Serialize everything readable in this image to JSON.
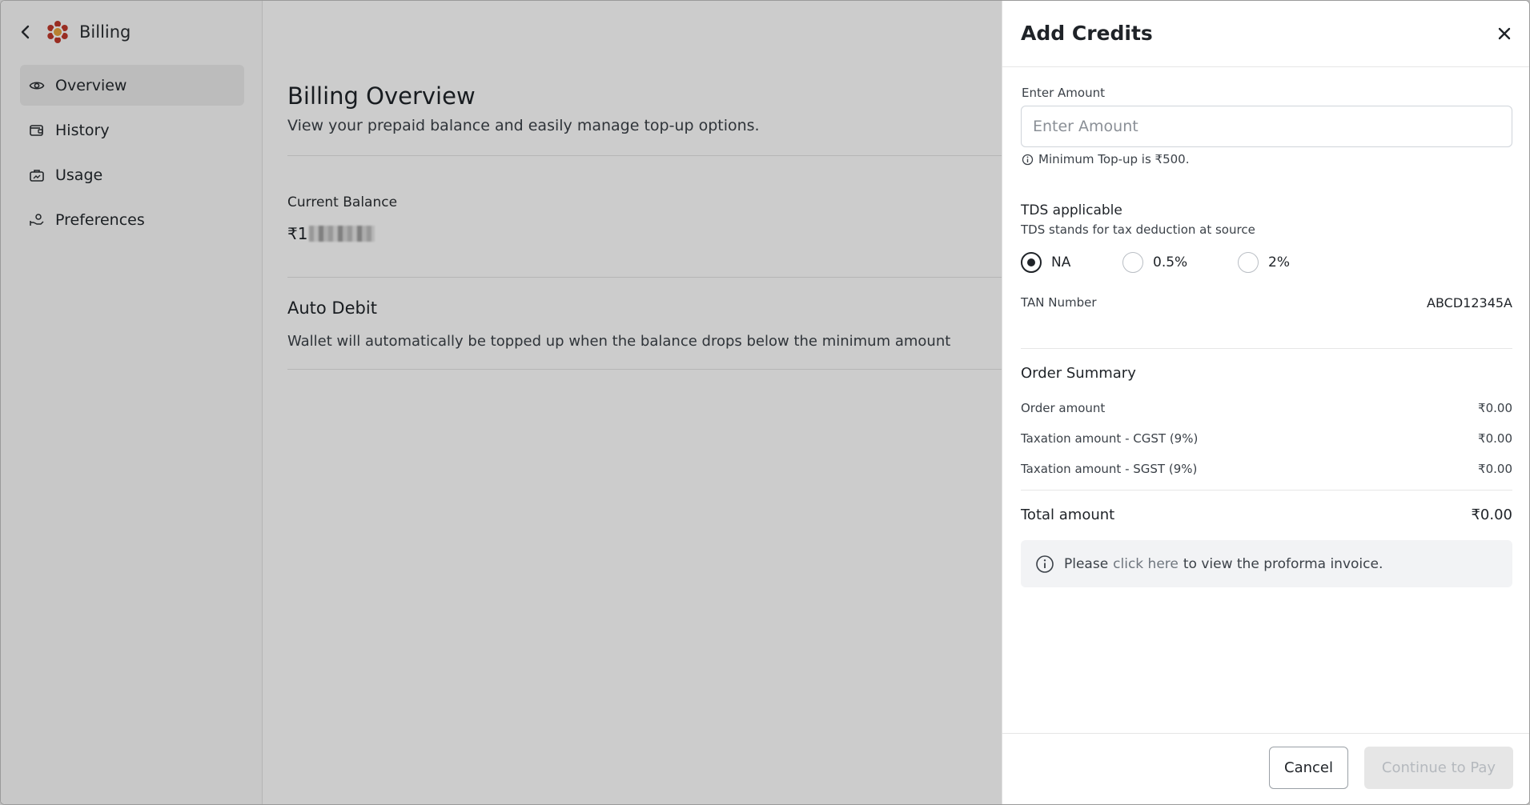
{
  "sidebar": {
    "title": "Billing",
    "items": [
      {
        "label": "Overview",
        "icon": "eye-icon",
        "active": true
      },
      {
        "label": "History",
        "icon": "wallet-icon"
      },
      {
        "label": "Usage",
        "icon": "briefcase-chart-icon"
      },
      {
        "label": "Preferences",
        "icon": "hand-coins-icon"
      }
    ]
  },
  "main": {
    "title": "Billing Overview",
    "subtitle": "View your prepaid balance and easily manage top-up options.",
    "current_balance_label": "Current Balance",
    "balance_prefix": "₹1",
    "auto_debit_title": "Auto Debit",
    "auto_debit_desc": "Wallet will automatically be topped up when the balance drops below the minimum amount"
  },
  "drawer": {
    "title": "Add Credits",
    "amount_label": "Enter Amount",
    "amount_placeholder": "Enter Amount",
    "amount_value": "",
    "min_hint": "Minimum Top-up is ₹500.",
    "tds_title": "TDS applicable",
    "tds_subtitle": "TDS stands for tax deduction at source",
    "tds_options": [
      {
        "label": "NA",
        "checked": true
      },
      {
        "label": "0.5%",
        "checked": false
      },
      {
        "label": "2%",
        "checked": false
      }
    ],
    "tan_label": "TAN Number",
    "tan_value": "ABCD12345A",
    "order_summary_title": "Order Summary",
    "order_rows": [
      {
        "label": "Order amount",
        "value": "₹0.00"
      },
      {
        "label": "Taxation amount - CGST (9%)",
        "value": "₹0.00"
      },
      {
        "label": "Taxation amount - SGST (9%)",
        "value": "₹0.00"
      }
    ],
    "total_label": "Total amount",
    "total_value": "₹0.00",
    "info_prefix": "Please",
    "info_link": "click here",
    "info_suffix": "to view the proforma invoice.",
    "cancel_label": "Cancel",
    "continue_label": "Continue to Pay"
  },
  "colors": {
    "accent_logo": "#c0392b",
    "logo_center": "#e6a23c",
    "overlay": "rgba(0,0,0,0.2)",
    "disabled_button_bg": "#e6e6e6"
  }
}
